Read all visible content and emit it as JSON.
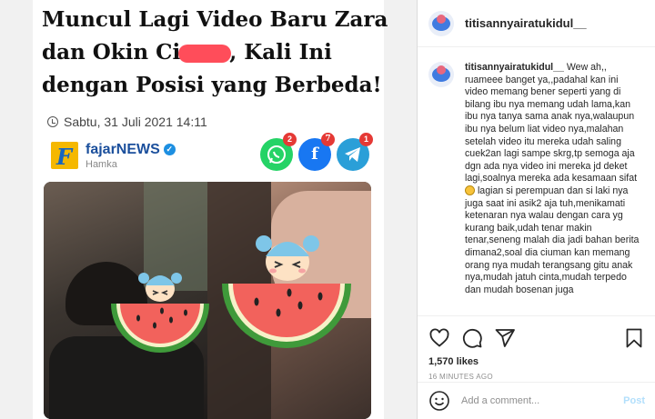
{
  "post": {
    "image": {
      "headline_lines": [
        "Muncul Lagi Video Baru Zara",
        [
          "dan Okin Ci",
          ", Kali Ini"
        ],
        "dengan Posisi yang Berbeda!"
      ],
      "date": "Sabtu, 31 Juli 2021 14:11",
      "source_name": "fajarNEWS",
      "source_logo_letter": "F",
      "author": "Hamka",
      "share_buttons": [
        {
          "name": "whatsapp",
          "count": "2",
          "color": "#25d366"
        },
        {
          "name": "facebook",
          "glyph": "f",
          "count": "7",
          "color": "#1877f2"
        },
        {
          "name": "telegram",
          "count": "1",
          "color": "#2a9fd8"
        }
      ]
    }
  },
  "header": {
    "username": "titisannyairatukidul__"
  },
  "caption": {
    "username": "titisannyairatukidul__",
    "text_part1": "Wew ah,, ruameee banget ya,,padahal kan ini video memang bener seperti yang di bilang ibu nya memang udah lama,kan ibu nya tanya sama anak nya,walaupun ibu nya belum liat video nya,malahan setelah video itu mereka udah saling cuek2an lagi sampe skrg,tp semoga aja dgn ada nya video ini mereka jd deket lagi,soalnya mereka ada kesamaan sifat",
    "text_part2": "lagian si perempuan dan si laki nya juga saat ini asik2 aja tuh,menikamati ketenaran nya walau dengan cara yg kurang baik,udah tenar makin tenar,seneng malah dia jadi bahan berita dimana2,soal dia ciuman kan memang orang nya mudah terangsang gitu anak nya,mudah jatuh cinta,mudah terpedo dan mudah bosenan juga"
  },
  "actions": {
    "likes": "1,570 likes",
    "timestamp": "16 MINUTES AGO"
  },
  "comment": {
    "placeholder": "Add a comment...",
    "post_label": "Post"
  },
  "icons": [
    "like-icon",
    "comment-icon",
    "share-icon",
    "save-icon",
    "emoji-icon",
    "clock-icon",
    "verified-icon"
  ],
  "colors": {
    "link_blue": "#b2dffc",
    "censor": "#ff4d5a",
    "source_blue": "#1b4f9c"
  }
}
